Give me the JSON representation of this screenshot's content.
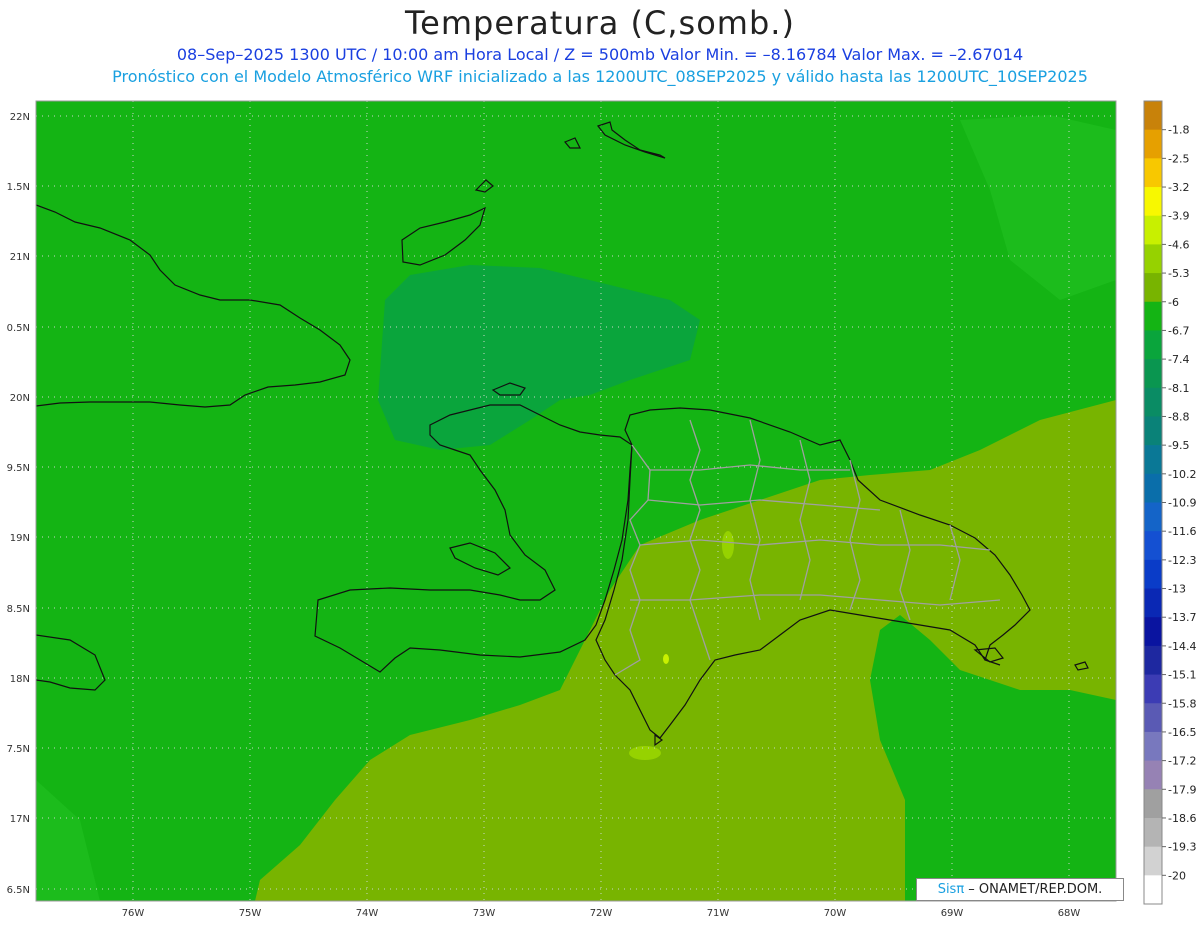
{
  "title": "Temperatura (C,somb.)",
  "subtitle_line1": "08–Sep–2025  1300 UTC / 10:00 am Hora Local / Z = 500mb  Valor Min. = –8.16784  Valor Max. = –2.67014",
  "subtitle_line2": "Pronóstico con el Modelo Atmosférico WRF inicializado a las 1200UTC_08SEP2025 y válido hasta las  1200UTC_10SEP2025",
  "credit": {
    "logo": "Sisπ",
    "text": " – ONAMET/REP.DOM."
  },
  "axes": {
    "lat_labels": [
      "22N",
      "1.5N",
      "21N",
      "0.5N",
      "20N",
      "9.5N",
      "19N",
      "8.5N",
      "18N",
      "7.5N",
      "17N",
      "6.5N"
    ],
    "lon_labels": [
      "76W",
      "75W",
      "74W",
      "73W",
      "72W",
      "71W",
      "70W",
      "69W",
      "68W"
    ]
  },
  "colorbar": {
    "labels": [
      "-1.8",
      "-2.5",
      "-3.2",
      "-3.9",
      "-4.6",
      "-5.3",
      "-6",
      "-6.7",
      "-7.4",
      "-8.1",
      "-8.8",
      "-9.5",
      "-10.2",
      "-10.9",
      "-11.6",
      "-12.3",
      "-13",
      "-13.7",
      "-14.4",
      "-15.1",
      "-15.8",
      "-16.5",
      "-17.2",
      "-17.9",
      "-18.6",
      "-19.3",
      "-20"
    ],
    "colors": [
      "#c8820a",
      "#e6a000",
      "#f8c800",
      "#f8f800",
      "#c8f000",
      "#96d200",
      "#78b400",
      "#14b414",
      "#0aa53c",
      "#0a9650",
      "#0a8c64",
      "#0a8278",
      "#0a7896",
      "#0a6eaa",
      "#1464c8",
      "#1450d2",
      "#0a3cc8",
      "#0a28b4",
      "#0a14a0",
      "#1e28a0",
      "#3c3cb4",
      "#5a5ab4",
      "#7878be",
      "#9682b4",
      "#a0a0a0",
      "#b4b4b4",
      "#d2d2d2",
      "#ffffff"
    ]
  }
}
